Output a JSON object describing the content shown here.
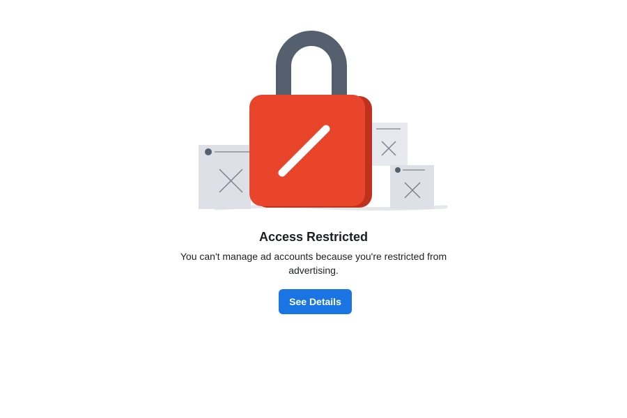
{
  "dialog": {
    "title": "Access Restricted",
    "message": "You can't manage ad accounts because you're restricted from advertising.",
    "button_label": "See Details"
  },
  "illustration": {
    "icon": "padlock-icon",
    "colors": {
      "lock_body": "#e8452c",
      "lock_shadow": "#c0311e",
      "shackle": "#55606e",
      "card": "#dde0e6"
    }
  },
  "colors": {
    "accent": "#1b74e4",
    "text": "#1c1e21",
    "background": "#ffffff"
  }
}
